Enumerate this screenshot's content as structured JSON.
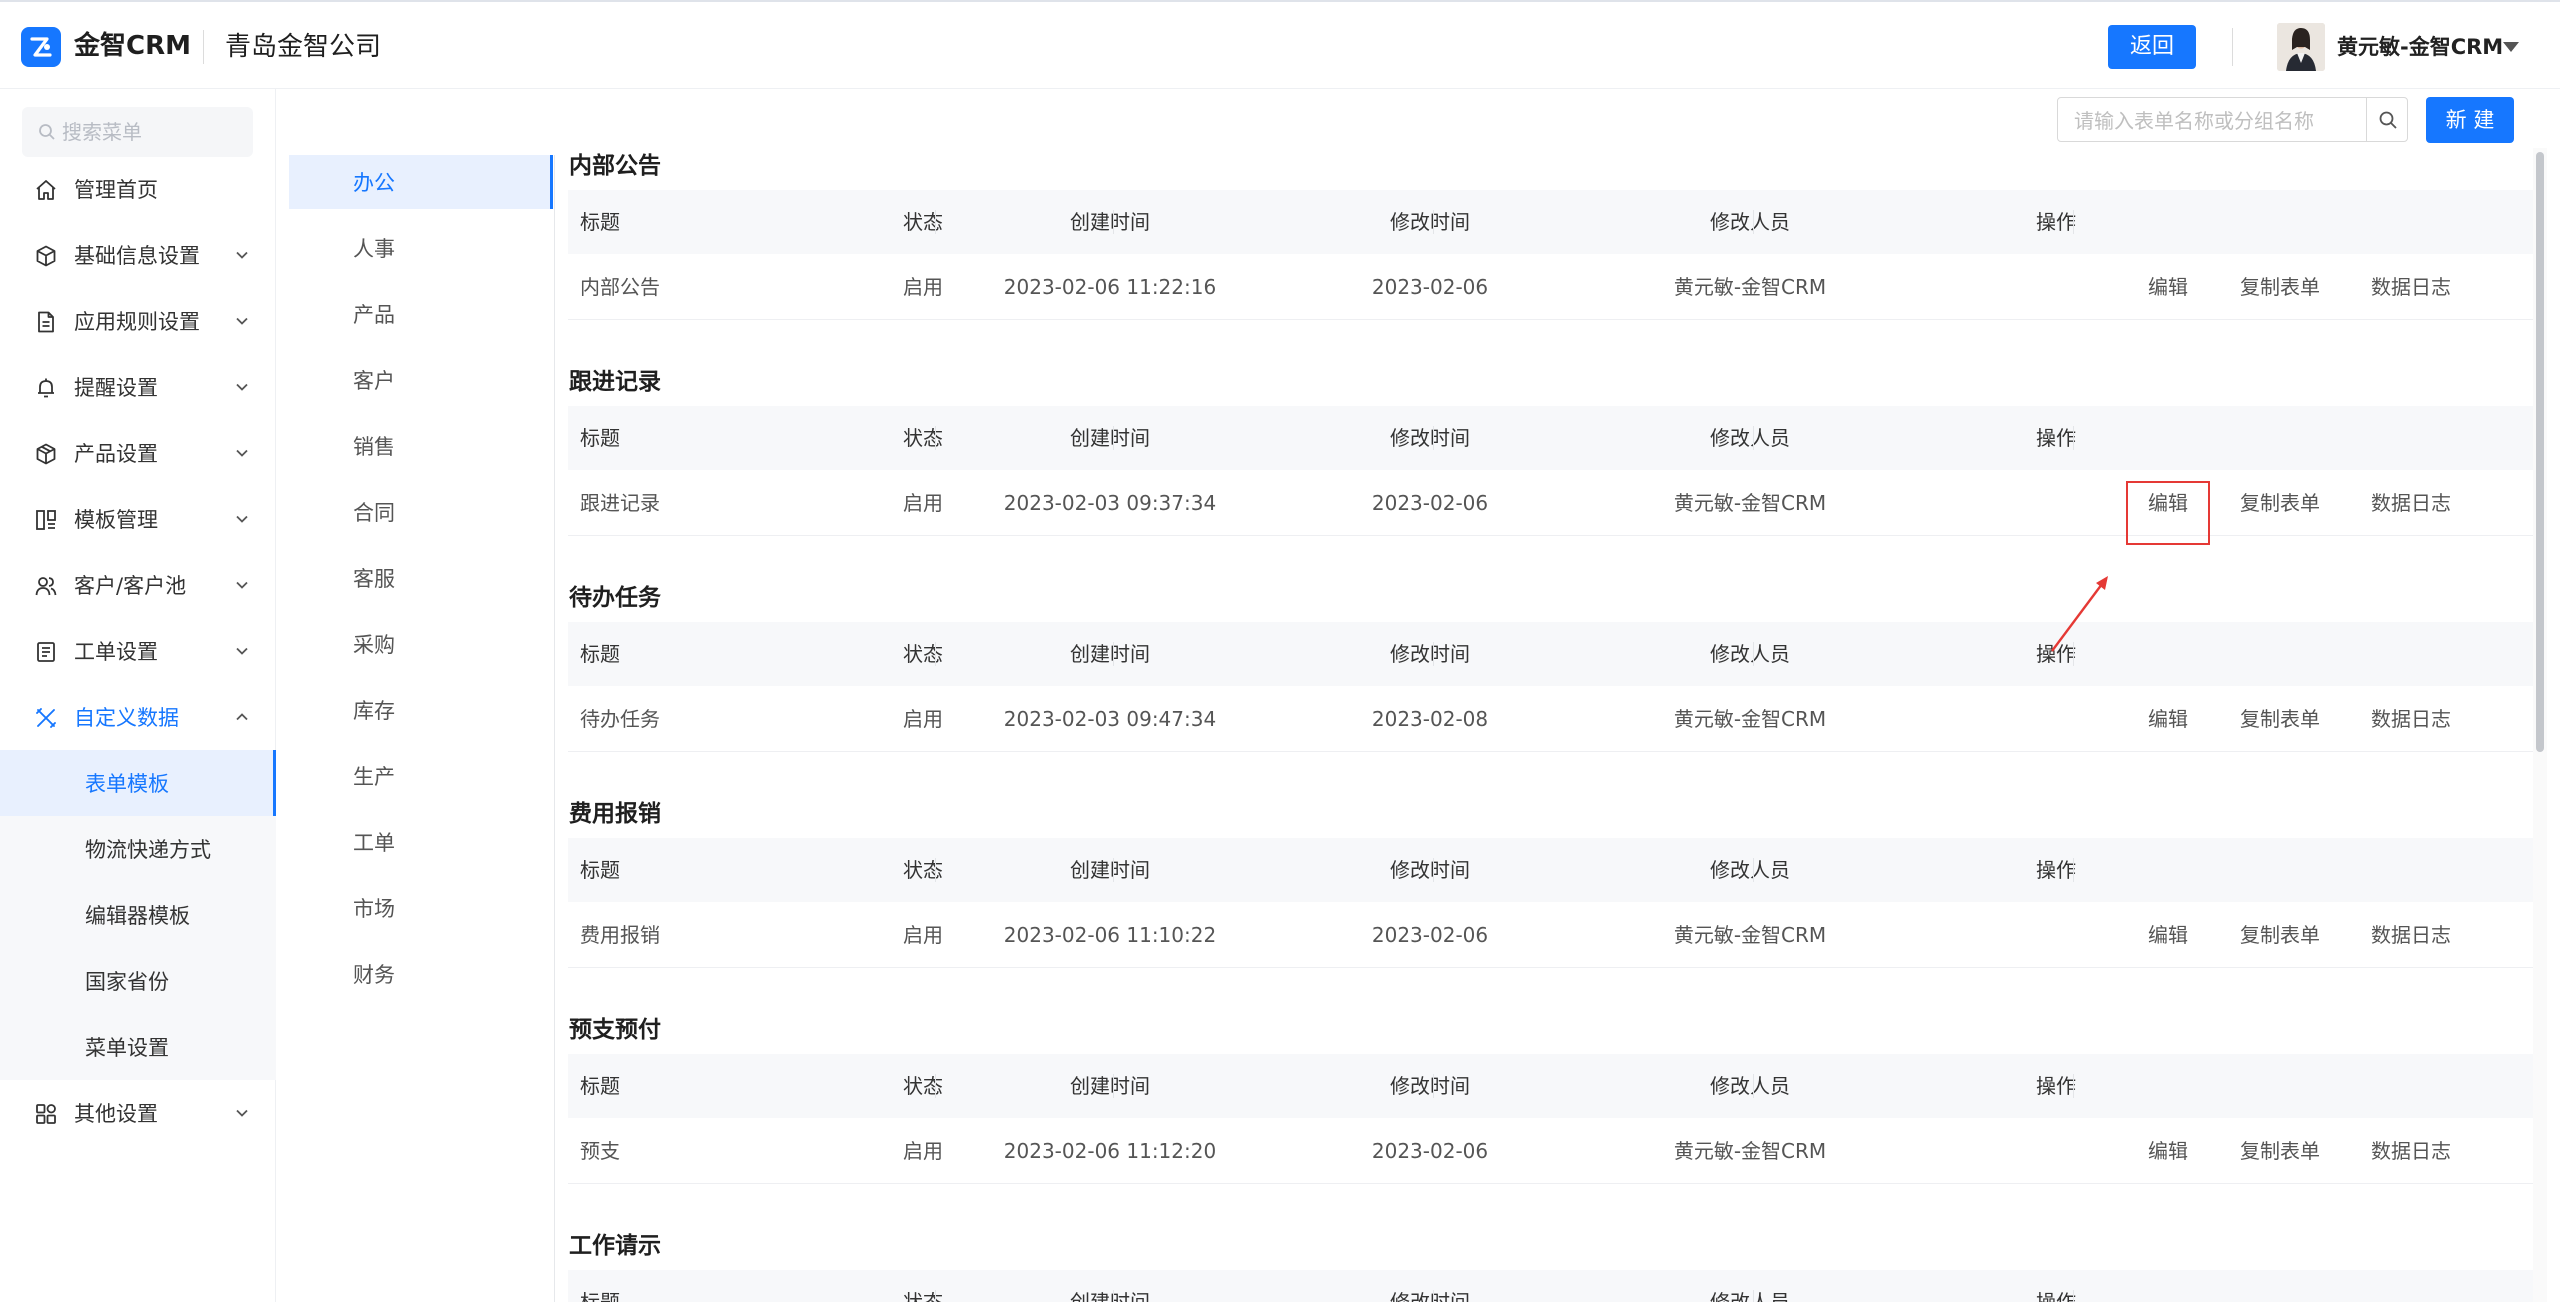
{
  "header": {
    "brand": "金智CRM",
    "company": "青岛金智公司",
    "back_label": "返回",
    "user_name": "黄元敏-金智CRM"
  },
  "sidebar": {
    "search_placeholder": "搜索菜单",
    "items": [
      {
        "label": "管理首页",
        "icon": "home-icon"
      },
      {
        "label": "基础信息设置",
        "icon": "cube-icon"
      },
      {
        "label": "应用规则设置",
        "icon": "document-icon"
      },
      {
        "label": "提醒设置",
        "icon": "bell-icon"
      },
      {
        "label": "产品设置",
        "icon": "box-icon"
      },
      {
        "label": "模板管理",
        "icon": "template-icon"
      },
      {
        "label": "客户/客户池",
        "icon": "customers-icon"
      },
      {
        "label": "工单设置",
        "icon": "ticket-icon"
      },
      {
        "label": "自定义数据",
        "icon": "tools-icon"
      }
    ],
    "sub_items": [
      "表单模板",
      "物流快递方式",
      "编辑器模板",
      "国家省份",
      "菜单设置"
    ],
    "other": {
      "label": "其他设置",
      "icon": "apps-icon"
    }
  },
  "categories": [
    "办公",
    "人事",
    "产品",
    "客户",
    "销售",
    "合同",
    "客服",
    "采购",
    "库存",
    "生产",
    "工单",
    "市场",
    "财务"
  ],
  "toolbar": {
    "search_placeholder": "请输入表单名称或分组名称",
    "new_label": "新 建"
  },
  "columns": [
    "标题",
    "状态",
    "创建时间",
    "修改时间",
    "修改人员",
    "操作"
  ],
  "actions": {
    "edit": "编辑",
    "copy": "复制表单",
    "log": "数据日志"
  },
  "sections": [
    {
      "title": "内部公告",
      "row": {
        "title": "内部公告",
        "status": "启用",
        "created": "2023-02-06 11:22:16",
        "modified": "2023-02-06",
        "modifier": "黄元敏-金智CRM"
      }
    },
    {
      "title": "跟进记录",
      "row": {
        "title": "跟进记录",
        "status": "启用",
        "created": "2023-02-03 09:37:34",
        "modified": "2023-02-06",
        "modifier": "黄元敏-金智CRM"
      }
    },
    {
      "title": "待办任务",
      "row": {
        "title": "待办任务",
        "status": "启用",
        "created": "2023-02-03 09:47:34",
        "modified": "2023-02-08",
        "modifier": "黄元敏-金智CRM"
      }
    },
    {
      "title": "费用报销",
      "row": {
        "title": "费用报销",
        "status": "启用",
        "created": "2023-02-06 11:10:22",
        "modified": "2023-02-06",
        "modifier": "黄元敏-金智CRM"
      }
    },
    {
      "title": "预支预付",
      "row": {
        "title": "预支",
        "status": "启用",
        "created": "2023-02-06 11:12:20",
        "modified": "2023-02-06",
        "modifier": "黄元敏-金智CRM"
      }
    },
    {
      "title": "工作请示"
    }
  ],
  "colors": {
    "accent": "#1677ff",
    "highlight": "#e53935"
  }
}
